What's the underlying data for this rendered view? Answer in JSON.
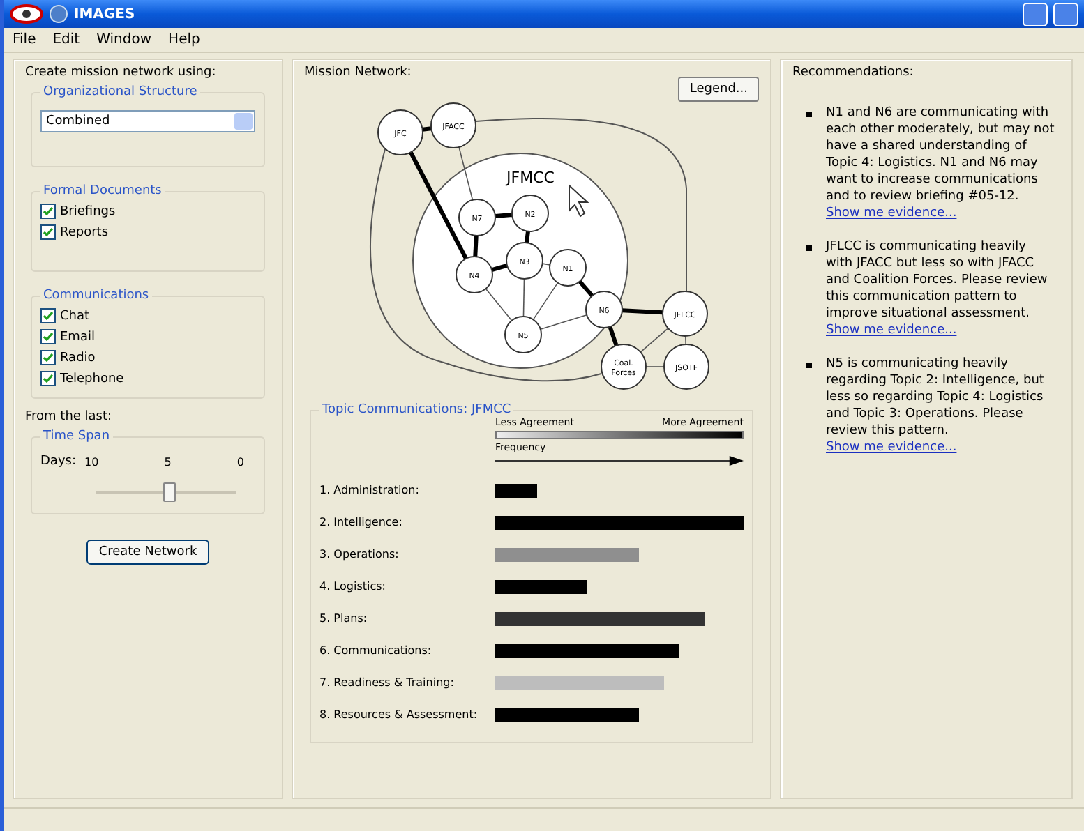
{
  "window": {
    "title": "IMAGES"
  },
  "menu": [
    "File",
    "Edit",
    "Window",
    "Help"
  ],
  "left": {
    "heading": "Create mission network using:",
    "org": {
      "legend": "Organizational Structure",
      "value": "Combined"
    },
    "docs": {
      "legend": "Formal Documents",
      "items": [
        {
          "label": "Briefings",
          "checked": true
        },
        {
          "label": "Reports",
          "checked": true
        }
      ]
    },
    "comms": {
      "legend": "Communications",
      "items": [
        {
          "label": "Chat",
          "checked": true
        },
        {
          "label": "Email",
          "checked": true
        },
        {
          "label": "Radio",
          "checked": true
        },
        {
          "label": "Telephone",
          "checked": true
        }
      ]
    },
    "from_label": "From the last:",
    "timespan": {
      "legend": "Time Span",
      "unit": "Days:",
      "ticks": [
        "10",
        "5",
        "0"
      ],
      "level": 0.52
    },
    "button": "Create Network"
  },
  "network": {
    "heading": "Mission Network:",
    "legend_button": "Legend...",
    "cluster": "JFMCC",
    "nodes": [
      {
        "label": "JFC"
      },
      {
        "label": "JFACC"
      },
      {
        "label": "N7"
      },
      {
        "label": "N2"
      },
      {
        "label": "N4"
      },
      {
        "label": "N3"
      },
      {
        "label": "N1"
      },
      {
        "label": "N6"
      },
      {
        "label": "N5"
      },
      {
        "label": "JFLCC"
      },
      {
        "label": "Coal. Forces"
      },
      {
        "label": "JSOTF"
      }
    ]
  },
  "topics": {
    "heading": "Topic Communications: JFMCC",
    "agree_low": "Less Agreement",
    "agree_high": "More Agreement",
    "frequency": "Frequency",
    "rows": [
      {
        "label": "1. Administration:",
        "color": "#000000"
      },
      {
        "label": "2. Intelligence:",
        "color": "#000000"
      },
      {
        "label": "3. Operations:",
        "color": "#8f8f8f"
      },
      {
        "label": "4. Logistics:",
        "color": "#000000"
      },
      {
        "label": "5. Plans:",
        "color": "#333333"
      },
      {
        "label": "6. Communications:",
        "color": "#000000"
      },
      {
        "label": "7. Readiness & Training:",
        "color": "#bdbdbd"
      },
      {
        "label": "8. Resources & Assessment:",
        "color": "#000000"
      }
    ]
  },
  "recommendations": {
    "heading": "Recommendations:",
    "items": [
      {
        "text": "N1 and N6 are communicating with each other moderately, but may not have a shared understanding of Topic 4: Logistics. N1 and N6 may want to increase communications and to review briefing #05-12.",
        "link": "Show me evidence..."
      },
      {
        "text": "JFLCC is communicating heavily with JFACC but less so with JFACC and Coalition Forces. Please review this communication pattern to improve situational assessment.",
        "link": "Show me evidence..."
      },
      {
        "text": "N5 is communicating heavily regarding Topic 2: Intelligence, but less so regarding Topic 4: Logistics and Topic 3: Operations. Please review this pattern.",
        "link": "Show me evidence..."
      }
    ]
  }
}
